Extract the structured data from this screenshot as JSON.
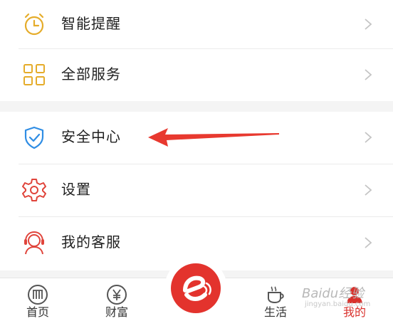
{
  "menu_group_1": [
    {
      "label": "智能提醒",
      "icon": "alarm-clock-icon"
    },
    {
      "label": "全部服务",
      "icon": "grid-services-icon"
    }
  ],
  "menu_group_2": [
    {
      "label": "安全中心",
      "icon": "shield-check-icon"
    },
    {
      "label": "设置",
      "icon": "gear-icon"
    },
    {
      "label": "我的客服",
      "icon": "customer-service-headset-icon"
    }
  ],
  "tabs": [
    {
      "label": "首页",
      "icon": "bank-logo-icon",
      "active": false
    },
    {
      "label": "财富",
      "icon": "yen-coin-icon",
      "active": false
    },
    {
      "label": "生活",
      "icon": "coffee-cup-icon",
      "active": false
    },
    {
      "label": "我的",
      "icon": "person-icon",
      "active": true
    }
  ],
  "center_button": {
    "icon": "app-logo-e-icon"
  },
  "annotation": {
    "type": "red-arrow-pointing-left",
    "color": "#e8392f"
  },
  "watermark": {
    "text": "Baidu经验",
    "sub": "jingyan.baidu.com"
  },
  "colors": {
    "accent_red": "#d9312c",
    "icon_gold": "#e5ac2a",
    "icon_blue": "#2f8de4",
    "icon_red": "#e0443b",
    "chevron": "#c4c4c4"
  }
}
